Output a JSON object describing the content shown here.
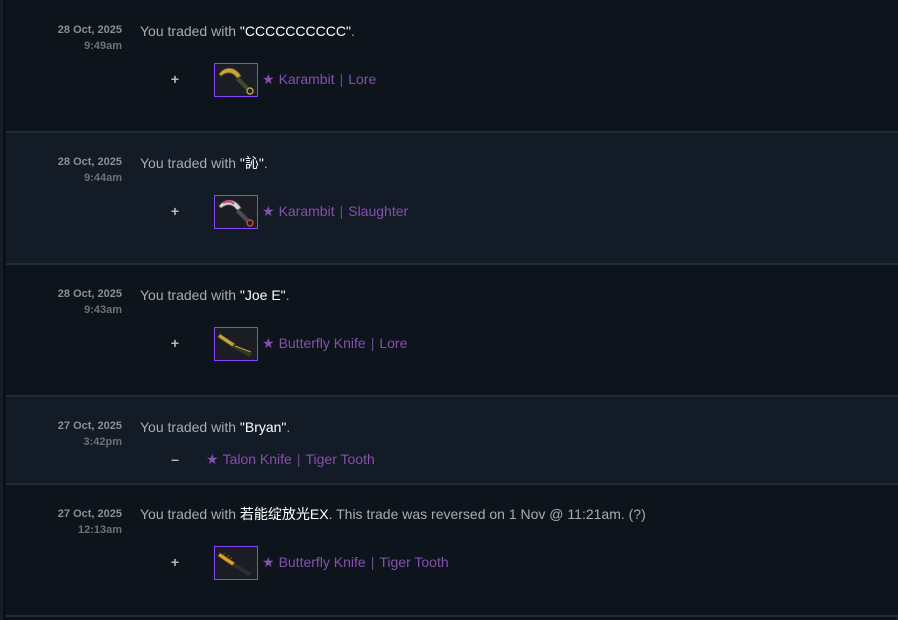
{
  "trades": [
    {
      "date": "28 Oct, 2025",
      "time": "9:49am",
      "desc_prefix": "You traded with ",
      "partner": "\"CCCCCCCCCC\"",
      "desc_suffix": ".",
      "sign": "+",
      "item_star": "★",
      "item_weapon": "Karambit",
      "item_sep": "|",
      "item_skin": "Lore",
      "thumb_icon": "karambit-lore-icon"
    },
    {
      "date": "28 Oct, 2025",
      "time": "9:44am",
      "desc_prefix": "You traded with ",
      "partner": "\"訫\"",
      "desc_suffix": ".",
      "sign": "+",
      "item_star": "★",
      "item_weapon": "Karambit",
      "item_sep": "|",
      "item_skin": "Slaughter",
      "thumb_icon": "karambit-slaughter-icon"
    },
    {
      "date": "28 Oct, 2025",
      "time": "9:43am",
      "desc_prefix": "You traded with ",
      "partner": "\"Joe E\"",
      "desc_suffix": ".",
      "sign": "+",
      "item_star": "★",
      "item_weapon": "Butterfly Knife",
      "item_sep": "|",
      "item_skin": "Lore",
      "thumb_icon": "butterfly-knife-lore-icon"
    },
    {
      "date": "27 Oct, 2025",
      "time": "3:42pm",
      "desc_prefix": "You traded with ",
      "partner": "\"Bryan\"",
      "desc_suffix": ".",
      "sign": "–",
      "item_star": "★",
      "item_weapon": "Talon Knife",
      "item_sep": "|",
      "item_skin": "Tiger Tooth"
    },
    {
      "date": "27 Oct, 2025",
      "time": "12:13am",
      "desc_prefix": "You traded with ",
      "partner": "若能绽放光EX",
      "desc_suffix": ". This trade was reversed on 1 Nov @ 11:21am. (?)",
      "sign": "+",
      "item_star": "★",
      "item_weapon": "Butterfly Knife",
      "item_sep": "|",
      "item_skin": "Tiger Tooth",
      "thumb_icon": "butterfly-knife-tiger-tooth-icon"
    }
  ],
  "colors": {
    "item_rarity": "#8650ac",
    "thumb_border": "#8847ff",
    "row_odd": "#0d141c",
    "row_even": "#131b26"
  }
}
